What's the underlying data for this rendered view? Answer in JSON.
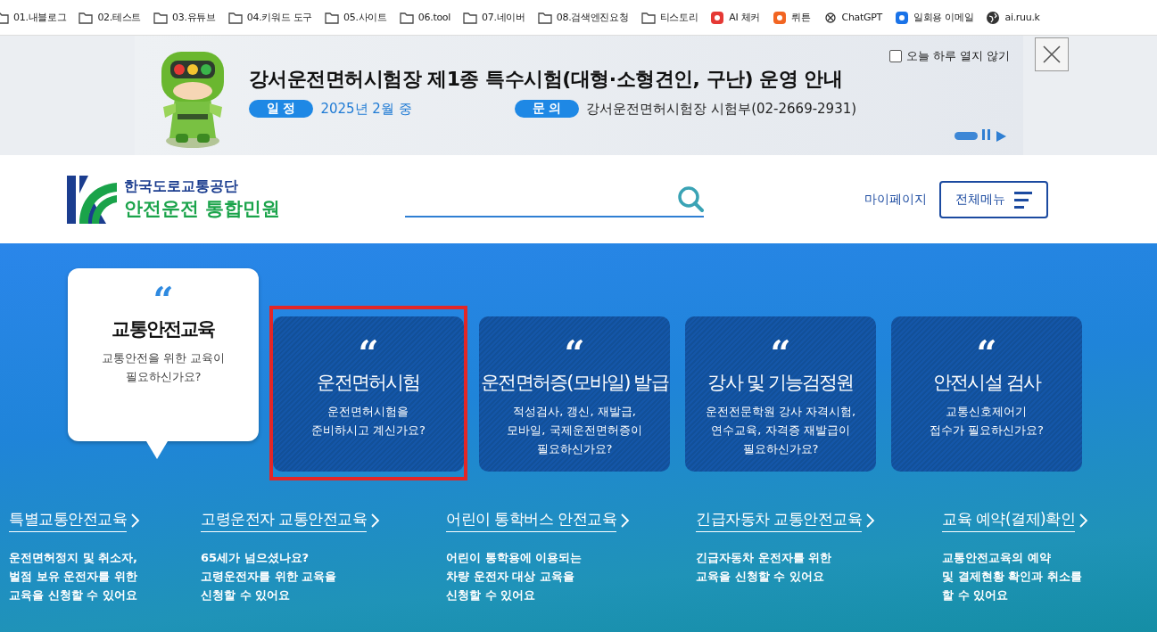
{
  "bookmarks": [
    {
      "label": "01.내블로그",
      "kind": "folder"
    },
    {
      "label": "02.테스트",
      "kind": "folder"
    },
    {
      "label": "03.유튜브",
      "kind": "folder"
    },
    {
      "label": "04.키워드 도구",
      "kind": "folder"
    },
    {
      "label": "05.사이트",
      "kind": "folder"
    },
    {
      "label": "06.tool",
      "kind": "folder"
    },
    {
      "label": "07.네이버",
      "kind": "folder"
    },
    {
      "label": "08.검색엔진요청",
      "kind": "folder"
    },
    {
      "label": "티스토리",
      "kind": "folder"
    },
    {
      "label": "AI 체커",
      "kind": "site",
      "color": "#e53935"
    },
    {
      "label": "뤼튼",
      "kind": "site",
      "color": "#f26522"
    },
    {
      "label": "ChatGPT",
      "kind": "knot"
    },
    {
      "label": "일회용 이메일",
      "kind": "site",
      "color": "#1a73e8"
    },
    {
      "label": "ai.ruu.k",
      "kind": "globe"
    }
  ],
  "banner": {
    "title": "강서운전면허시험장 제1종 특수시험(대형·소형견인, 구난) 운영 안내",
    "details": [
      {
        "label": "일 정",
        "value": "2025년 2월 중",
        "kind": "date"
      },
      {
        "label": "문 의",
        "value": "강서운전면허시험장 시험부(02-2669-2931)",
        "kind": "contact"
      }
    ],
    "dismiss": {
      "label": "오늘 하루 열지 않기",
      "checked": false
    },
    "paused": false
  },
  "header": {
    "org": "한국도로교통공단",
    "service": "안전운전 통합민원",
    "mypage": "마이페이지",
    "menu": "전체메뉴"
  },
  "cards": [
    {
      "kind": "bubble",
      "quote": "“",
      "title": "교통안전교육",
      "text": "교통안전을 위한 교육이\n필요하신가요?"
    },
    {
      "kind": "tile",
      "quote": "“",
      "title": "운전면허시험",
      "text": "운전면허시험을\n준비하시고 계신가요?",
      "highlighted": true
    },
    {
      "kind": "tile",
      "quote": "“",
      "title": "운전면허증(모바일) 발급",
      "text": "적성검사, 갱신, 재발급,\n모바일, 국제운전면허증이\n필요하신가요?",
      "highlighted": false
    },
    {
      "kind": "tile",
      "quote": "“",
      "title": "강사 및 기능검정원",
      "text": "운전전문학원 강사 자격시험,\n연수교육, 자격증 재발급이\n필요하신가요?",
      "highlighted": false
    },
    {
      "kind": "tile",
      "quote": "“",
      "title": "안전시설 검사",
      "text": "교통신호제어기\n접수가 필요하신가요?",
      "highlighted": false
    }
  ],
  "links": [
    {
      "title": "특별교통안전교육",
      "text": "운전면허정지 및 취소자,\n벌점 보유 운전자를 위한\n교육을 신청할 수 있어요"
    },
    {
      "title": "고령운전자 교통안전교육",
      "text": "65세가 넘으셨나요?\n고령운전자를 위한 교육을\n신청할 수 있어요"
    },
    {
      "title": "어린이 통학버스 안전교육",
      "text": "어린이 통학용에 이용되는\n차량 운전자 대상 교육을\n신청할 수 있어요"
    },
    {
      "title": "긴급자동차 교통안전교육",
      "text": "긴급자동차 운전자를 위한\n교육을 신청할 수 있어요"
    },
    {
      "title": "교육 예약(결제)확인",
      "text": "교통안전교육의 예약\n및 결제현황 확인과 취소를\n할 수 있어요"
    }
  ]
}
